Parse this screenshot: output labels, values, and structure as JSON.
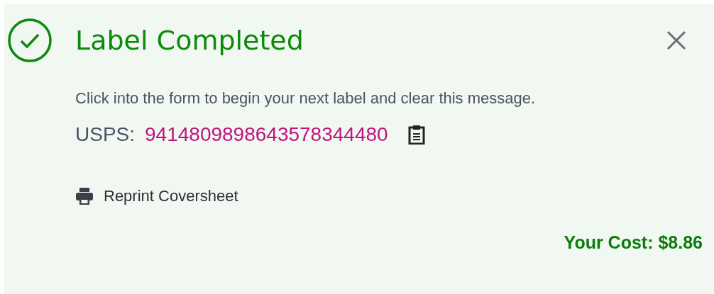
{
  "panel": {
    "title": "Label Completed",
    "message": "Click into the form to begin your next label and clear this message.",
    "tracking": {
      "carrier": "USPS:",
      "number": "9414809898643578344480"
    },
    "reprint": {
      "label": "Reprint Coversheet"
    },
    "cost": "Your Cost: $8.86"
  }
}
